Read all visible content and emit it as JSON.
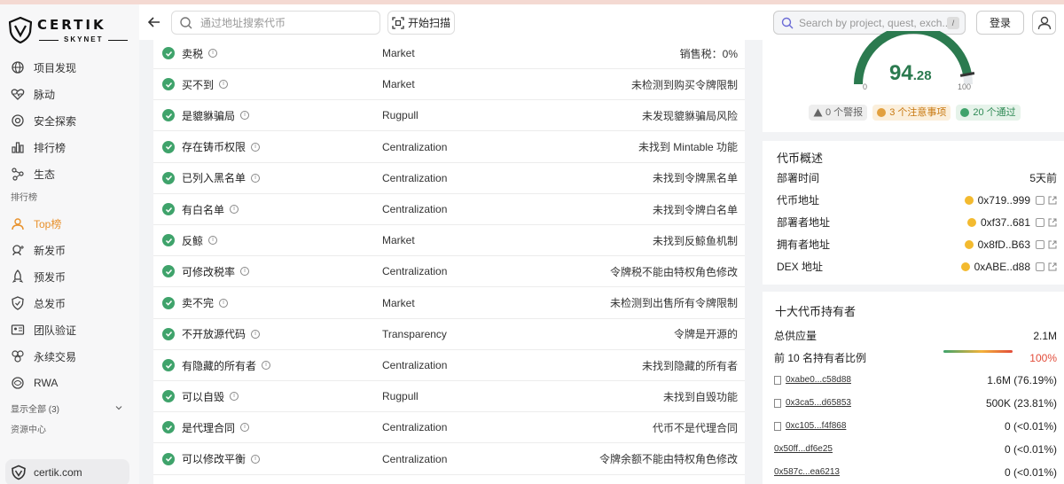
{
  "brand": {
    "name": "CERTIK",
    "sub": "SKYNET",
    "footer_link": "certik.com"
  },
  "sidebar": {
    "items": [
      {
        "label": "项目发现",
        "icon": "globe-icon"
      },
      {
        "label": "脉动",
        "icon": "heartbeat-icon"
      },
      {
        "label": "安全探索",
        "icon": "target-icon"
      },
      {
        "label": "排行榜",
        "icon": "bar-chart-icon"
      },
      {
        "label": "生态",
        "icon": "network-icon"
      }
    ],
    "section_leaderboard": "排行榜",
    "leaderboard_items": [
      {
        "label": "Top榜",
        "icon": "crown-icon",
        "active": true
      },
      {
        "label": "新发币",
        "icon": "new-coin-icon"
      },
      {
        "label": "预发币",
        "icon": "rocket-icon"
      },
      {
        "label": "总发币",
        "icon": "shield-icon"
      },
      {
        "label": "团队验证",
        "icon": "id-card-icon"
      },
      {
        "label": "永续交易",
        "icon": "cubes-icon"
      },
      {
        "label": "RWA",
        "icon": "rwa-icon"
      }
    ],
    "show_all": "显示全部 (3)",
    "section_resources": "资源中心"
  },
  "header": {
    "addr_search_placeholder": "通过地址搜索代币",
    "scan_label": "开始扫描",
    "project_search_placeholder": "Search by project, quest, exch...",
    "kbd": "/",
    "login_label": "登录"
  },
  "checks": [
    {
      "name": "卖税",
      "category": "Market",
      "result": "销售税：0%"
    },
    {
      "name": "买不到",
      "category": "Market",
      "result": "未检测到购买令牌限制"
    },
    {
      "name": "是貔貅骗局",
      "category": "Rugpull",
      "result": "未发现貔貅骗局风险"
    },
    {
      "name": "存在铸币权限",
      "category": "Centralization",
      "result": "未找到 Mintable 功能"
    },
    {
      "name": "已列入黑名单",
      "category": "Centralization",
      "result": "未找到令牌黑名单"
    },
    {
      "name": "有白名单",
      "category": "Centralization",
      "result": "未找到令牌白名单"
    },
    {
      "name": "反鲸",
      "category": "Market",
      "result": "未找到反鲸鱼机制"
    },
    {
      "name": "可修改税率",
      "category": "Centralization",
      "result": "令牌税不能由特权角色修改"
    },
    {
      "name": "卖不完",
      "category": "Market",
      "result": "未检测到出售所有令牌限制"
    },
    {
      "name": "不开放源代码",
      "category": "Transparency",
      "result": "令牌是开源的"
    },
    {
      "name": "有隐藏的所有者",
      "category": "Centralization",
      "result": "未找到隐藏的所有者"
    },
    {
      "name": "可以自毁",
      "category": "Rugpull",
      "result": "未找到自毁功能"
    },
    {
      "name": "是代理合同",
      "category": "Centralization",
      "result": "代币不是代理合同"
    },
    {
      "name": "可以修改平衡",
      "category": "Centralization",
      "result": "令牌余额不能由特权角色修改"
    }
  ],
  "score": {
    "int": "94",
    "dec": ".28",
    "min": "0",
    "max": "100",
    "value": 94.28,
    "warnings": "0 个警报",
    "notes": "3 个注意事项",
    "passed": "20 个通过"
  },
  "overview": {
    "title": "代币概述",
    "rows": [
      {
        "label": "部署时间",
        "value": "5天前",
        "coin": false
      },
      {
        "label": "代币地址",
        "value": "0x719..999",
        "coin": true
      },
      {
        "label": "部署者地址",
        "value": "0xf37..681",
        "coin": true
      },
      {
        "label": "拥有者地址",
        "value": "0x8fD..B63",
        "coin": true
      },
      {
        "label": "DEX 地址",
        "value": "0xABE..d88",
        "coin": true
      }
    ]
  },
  "holders": {
    "title": "十大代币持有者",
    "total_label": "总供应量",
    "total_value": "2.1M",
    "ratio_label": "前 10 名持有者比例",
    "ratio_value": "100%",
    "list": [
      {
        "addr": "0xabe0...c58d88",
        "amount": "1.6M (76.19%)",
        "doc": true
      },
      {
        "addr": "0x3ca5...d65853",
        "amount": "500K (23.81%)",
        "doc": true
      },
      {
        "addr": "0xc105...f4f868",
        "amount": "0 (<0.01%)",
        "doc": true
      },
      {
        "addr": "0x50ff...df6e25",
        "amount": "0 (<0.01%)",
        "doc": false
      },
      {
        "addr": "0x587c...ea6213",
        "amount": "0 (<0.01%)",
        "doc": false
      }
    ]
  },
  "colors": {
    "pass": "#3fa36b",
    "note": "#c8780f",
    "accent": "#e8912b",
    "gauge": "#2b7a4f"
  }
}
